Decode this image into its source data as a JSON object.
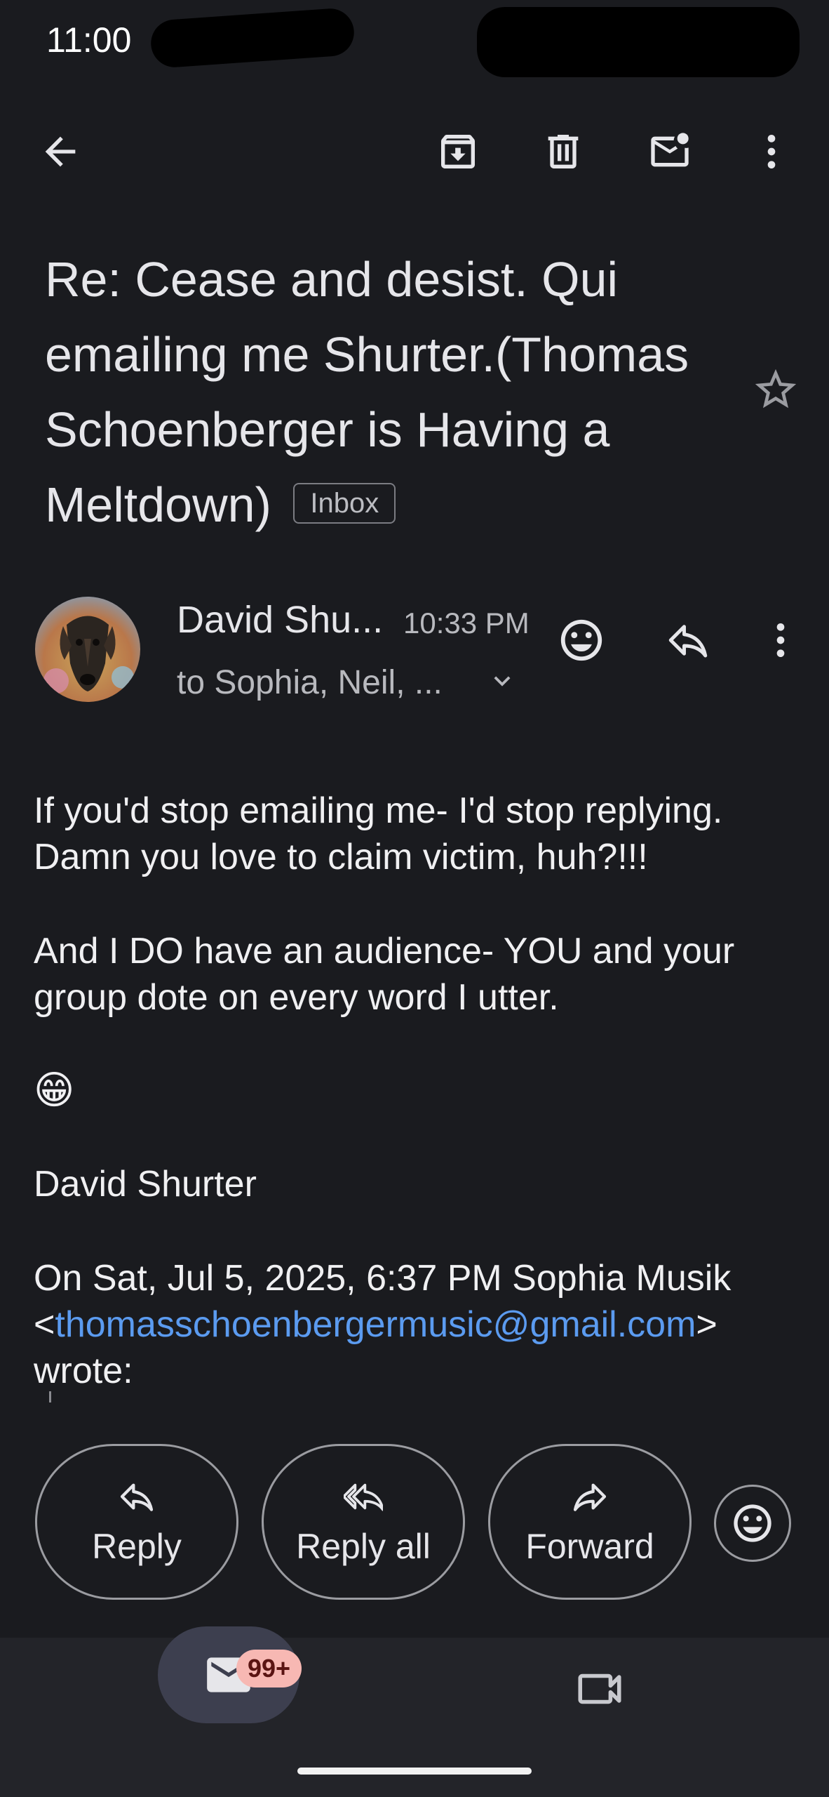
{
  "status_bar": {
    "time": "11:00"
  },
  "toolbar": {
    "back": "back-arrow-icon",
    "archive": "archive-icon",
    "delete": "trash-icon",
    "mark_unread": "mark-unread-icon",
    "more": "more-vert-icon"
  },
  "subject": {
    "text": "Re: Cease and desist. Qui emailing me Shurter.(Thomas Schoenberger is Having a Meltdown)",
    "label": "Inbox"
  },
  "message": {
    "sender_name": "David Shu...",
    "time": "10:33 PM",
    "recipients": "to Sophia, Neil, ...",
    "body": {
      "p1_line1": "If you'd stop emailing me- I'd stop replying.",
      "p1_line2": "Damn you love to claim victim, huh?!!!",
      "p2_line1": "And I DO have an audience- YOU and your",
      "p2_line2": "group dote on every word I utter.",
      "emoji": "😁",
      "signature": "David Shurter",
      "quote_line1": "On Sat, Jul 5, 2025, 6:37 PM Sophia Musik",
      "quote_lt": "<",
      "quote_email": "thomasschoenbergermusic@gmail.com",
      "quote_gt": ">",
      "quote_line3": "wrote:"
    }
  },
  "actions": {
    "reply": "Reply",
    "reply_all": "Reply all",
    "forward": "Forward"
  },
  "nav": {
    "mail_badge": "99+"
  },
  "colors": {
    "background": "#1a1b1f",
    "link": "#5b9bf0",
    "badge_bg": "#f7b8b3",
    "nav_bg": "#232429"
  }
}
